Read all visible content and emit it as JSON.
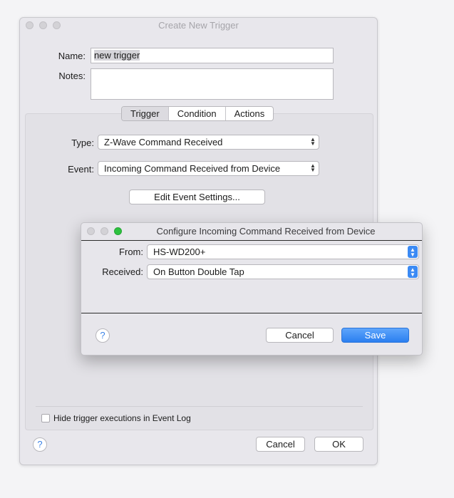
{
  "window": {
    "title": "Create New Trigger",
    "name_label": "Name:",
    "name_value": "new trigger",
    "notes_label": "Notes:",
    "notes_value": "",
    "tabs": [
      {
        "label": "Trigger"
      },
      {
        "label": "Condition"
      },
      {
        "label": "Actions"
      }
    ],
    "type_label": "Type:",
    "type_value": "Z-Wave Command Received",
    "event_label": "Event:",
    "event_value": "Incoming Command Received from Device",
    "edit_settings_label": "Edit Event Settings...",
    "hide_executions_label": "Hide trigger executions in Event Log",
    "help_label": "?",
    "cancel_label": "Cancel",
    "ok_label": "OK"
  },
  "dialog": {
    "title": "Configure Incoming Command Received from Device",
    "from_label": "From:",
    "from_value": "HS-WD200+",
    "received_label": "Received:",
    "received_value": "On Button Double Tap",
    "help_label": "?",
    "cancel_label": "Cancel",
    "save_label": "Save"
  },
  "colors": {
    "accent": "#2b7ff0",
    "window_bg": "#e8e7ec",
    "traffic_green": "#2dc23f"
  }
}
